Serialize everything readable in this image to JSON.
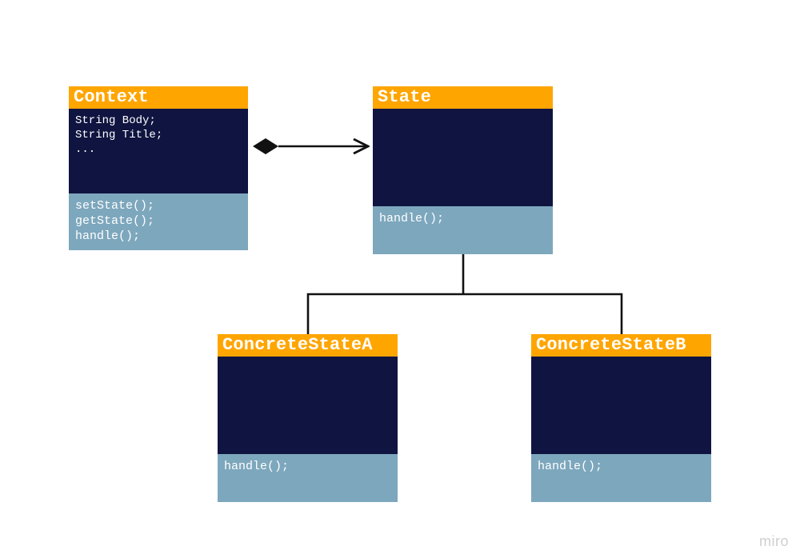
{
  "colors": {
    "header": "#ffa500",
    "body": "#0f1440",
    "methods": "#7da7bd",
    "text": "#ffffff",
    "connector": "#111111"
  },
  "watermark": "miro",
  "classes": {
    "context": {
      "title": "Context",
      "attributes": "String Body;\nString Title;\n...",
      "methods": "setState();\ngetState();\nhandle();"
    },
    "state": {
      "title": "State",
      "attributes": "",
      "methods": "handle();"
    },
    "concreteA": {
      "title": "ConcreteStateA",
      "attributes": "",
      "methods": "handle();"
    },
    "concreteB": {
      "title": "ConcreteStateB",
      "attributes": "",
      "methods": "handle();"
    }
  },
  "relationships": [
    {
      "from": "context",
      "to": "state",
      "type": "composition-arrow"
    },
    {
      "from": "state",
      "to": "concreteA",
      "type": "generalization-branch"
    },
    {
      "from": "state",
      "to": "concreteB",
      "type": "generalization-branch"
    }
  ]
}
